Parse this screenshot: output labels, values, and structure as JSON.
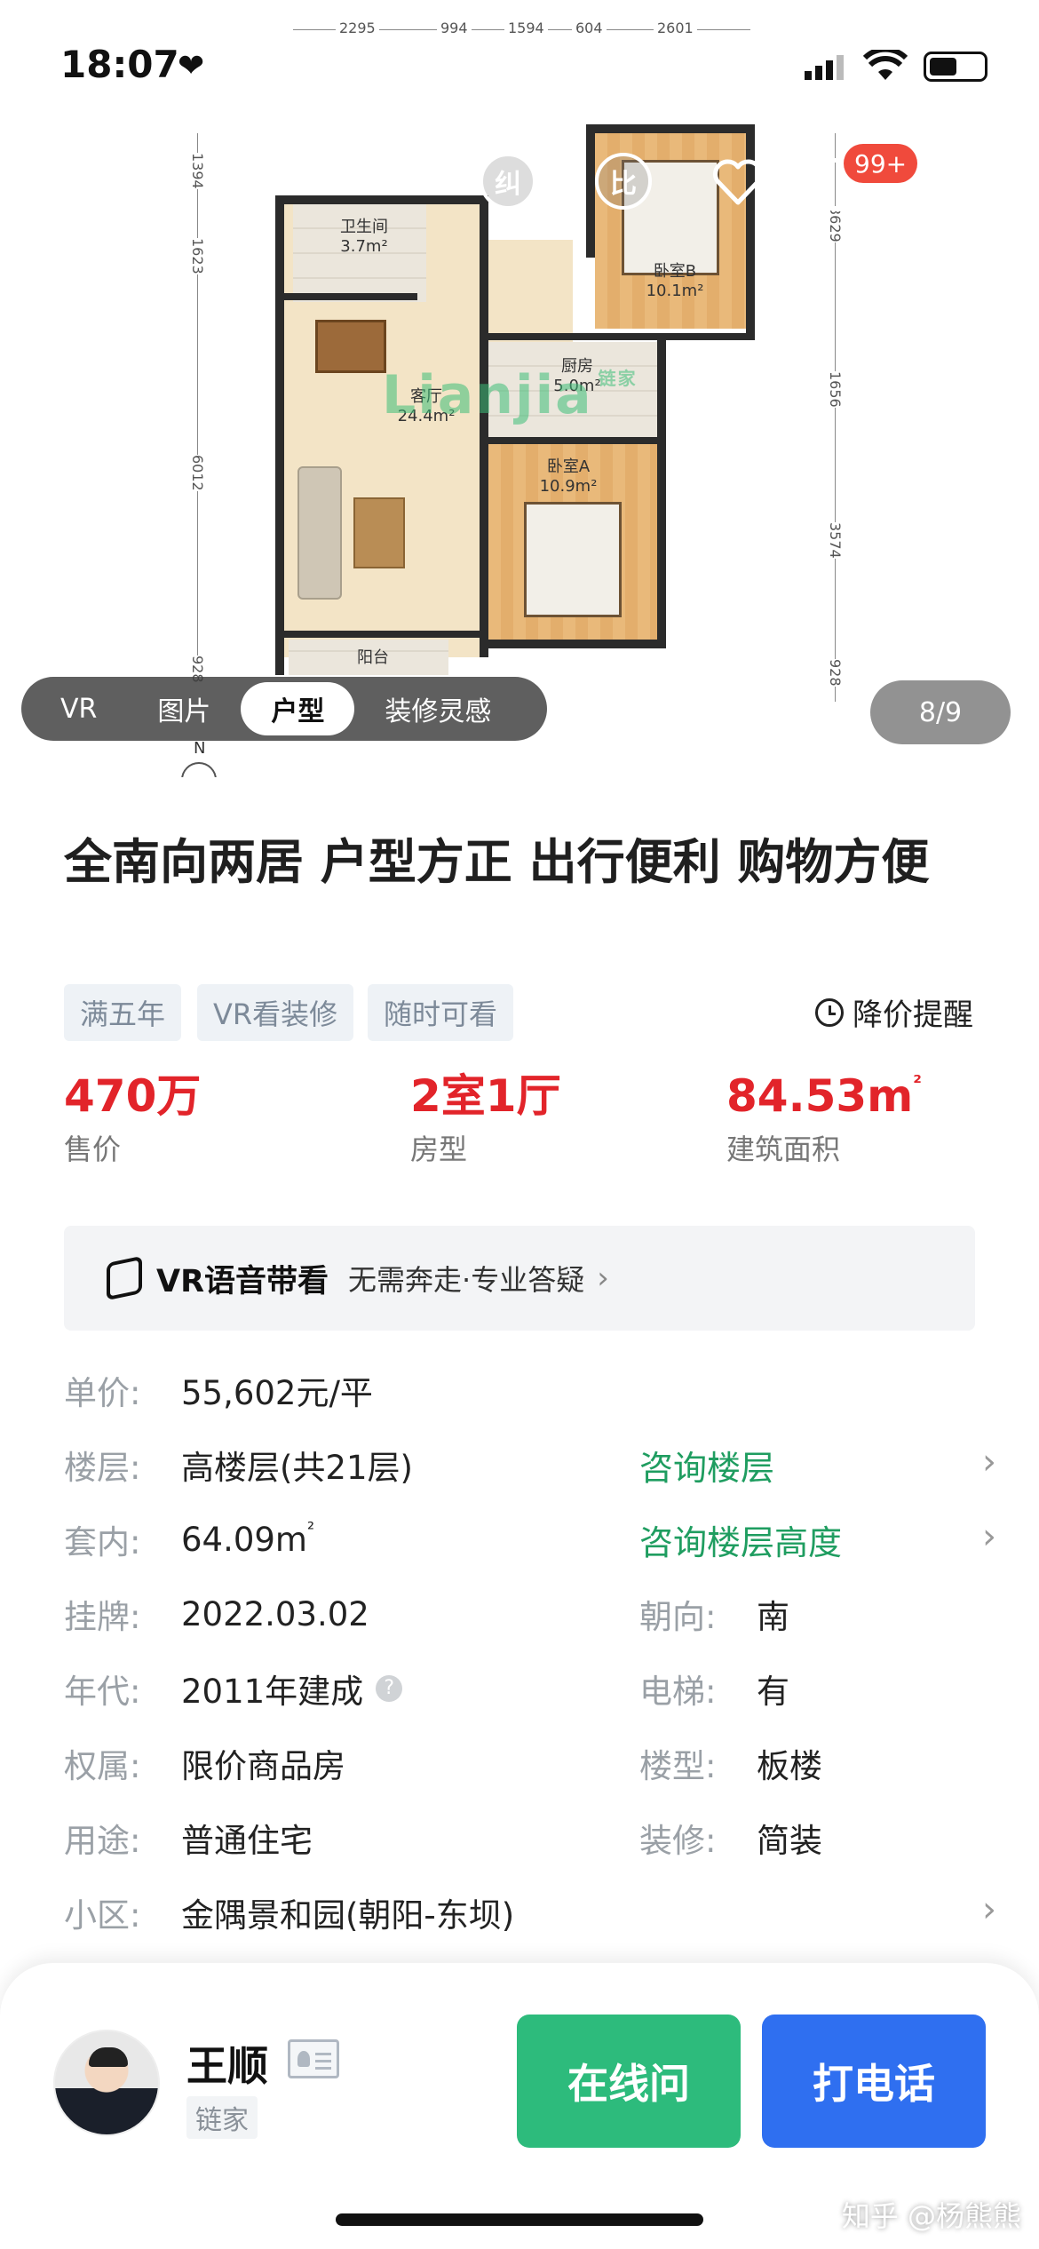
{
  "status_bar": {
    "time": "18:07"
  },
  "hero": {
    "dimensions_top": [
      "2295",
      "994",
      "1594",
      "604",
      "2601"
    ],
    "dimensions_left": [
      "1394",
      "1623",
      "6012",
      "928"
    ],
    "dimensions_right": [
      "3629",
      "1656",
      "3574",
      "928"
    ],
    "rooms": {
      "bathroom": {
        "name": "卫生间",
        "area": "3.7m²"
      },
      "bedroom_b": {
        "name": "卧室B",
        "area": "10.1m²"
      },
      "kitchen": {
        "name": "厨房",
        "area": "5.0m²"
      },
      "living": {
        "name": "客厅",
        "area": "24.4m²"
      },
      "bedroom_a": {
        "name": "卧室A",
        "area": "10.9m²"
      },
      "balcony": {
        "name": "阳台"
      }
    },
    "plan_watermark": "Lianjia",
    "plan_watermark_brand": "链家",
    "compass_label": "N",
    "icons": {
      "correct": "纠",
      "compare": "比",
      "badge": "99+"
    },
    "media_tabs": [
      "VR",
      "图片",
      "户型",
      "装修灵感"
    ],
    "active_tab": "户型",
    "page_counter": "8/9"
  },
  "listing": {
    "title": "全南向两居 户型方正 出行便利 购物方便",
    "tags": [
      "满五年",
      "VR看装修",
      "随时可看"
    ],
    "price_alert": "降价提醒",
    "stats": [
      {
        "value": "470万",
        "label": "售价"
      },
      {
        "value": "2室1厅",
        "label": "房型"
      },
      {
        "value": "84.53m",
        "sup": "²",
        "label": "建筑面积"
      }
    ],
    "vr_bar": {
      "title": "VR语音带看",
      "subtitle": "无需奔走·专业答疑"
    },
    "info": {
      "unit_price": {
        "label": "单价:",
        "value": "55,602元/平"
      },
      "floor": {
        "label": "楼层:",
        "value": "高楼层(共21层)",
        "link": "咨询楼层"
      },
      "inner_area": {
        "label": "套内:",
        "value": "64.09m",
        "sup": "²",
        "link": "咨询楼层高度"
      },
      "listed": {
        "label": "挂牌:",
        "value": "2022.03.02"
      },
      "orientation": {
        "label": "朝向:",
        "value": "南"
      },
      "year": {
        "label": "年代:",
        "value": "2011年建成"
      },
      "elevator": {
        "label": "电梯:",
        "value": "有"
      },
      "ownership": {
        "label": "权属:",
        "value": "限价商品房"
      },
      "building_type": {
        "label": "楼型:",
        "value": "板楼"
      },
      "usage": {
        "label": "用途:",
        "value": "普通住宅"
      },
      "decoration": {
        "label": "装修:",
        "value": "简装"
      },
      "community": {
        "label": "小区:",
        "value": "金隅景和园(朝阳-东坝)"
      }
    }
  },
  "agent": {
    "name": "王顺",
    "org": "链家",
    "chat_button": "在线问",
    "call_button": "打电话"
  },
  "watermark": "知乎 @杨熊熊",
  "colors": {
    "price_red": "#e2242a",
    "link_green": "#1f9d60",
    "chat_green": "#2dbb7c",
    "call_blue": "#2f6ff0",
    "badge_red": "#f04a3c"
  }
}
